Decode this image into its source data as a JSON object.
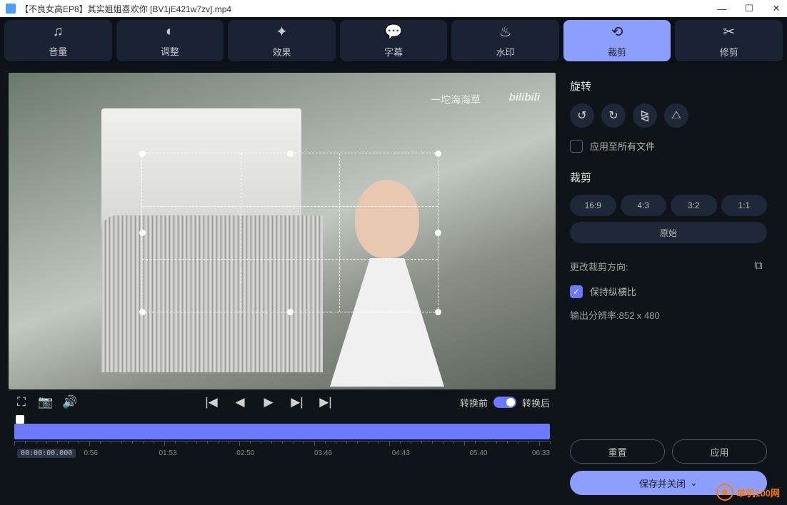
{
  "titlebar": {
    "title": "【不良女高EP8】其实姐姐喜欢你 [BV1jE421w7zv].mp4"
  },
  "toolbar": {
    "volume": "音量",
    "adjust": "调整",
    "effect": "效果",
    "subtitle": "字幕",
    "watermark": "水印",
    "crop": "裁剪",
    "trim": "修剪"
  },
  "video": {
    "wm1": "一坨海海草",
    "wm2": "bilibili"
  },
  "player": {
    "before": "转换前",
    "after": "转换后"
  },
  "timeline": {
    "timecode": "00:00:00.000",
    "labels": [
      "0:56",
      "01:53",
      "02:50",
      "03:46",
      "04:43",
      "05:40",
      "06:33"
    ]
  },
  "side": {
    "rotate_title": "旋转",
    "apply_all": "应用至所有文件",
    "crop_title": "裁剪",
    "ratios": [
      "16:9",
      "4:3",
      "3:2",
      "1:1"
    ],
    "ratio_original": "原始",
    "change_dir": "更改裁剪方向:",
    "keep_aspect": "保持纵横比",
    "resolution_label": "输出分辨率:",
    "resolution_value": "852 x 480",
    "reset": "重置",
    "apply": "应用",
    "save_close": "保存并关闭"
  },
  "watermark_badge": "单机100网"
}
